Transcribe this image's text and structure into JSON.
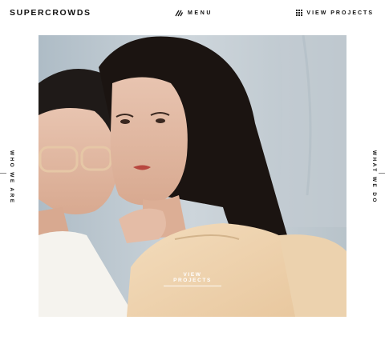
{
  "header": {
    "logo": "SUPERCROWDS",
    "menu_label": "MENU",
    "menu_icon": "slash-lines-icon",
    "view_projects_label": "VIEW PROJECTS",
    "view_projects_icon": "grid-dots-icon"
  },
  "side_nav": {
    "left_label": "WHO WE ARE",
    "right_label": "WHAT WE DO"
  },
  "hero": {
    "cta_label": "VIEW PROJECTS"
  },
  "colors": {
    "text": "#111111",
    "background": "#ffffff",
    "hero_backdrop": "#c9d2d8"
  }
}
